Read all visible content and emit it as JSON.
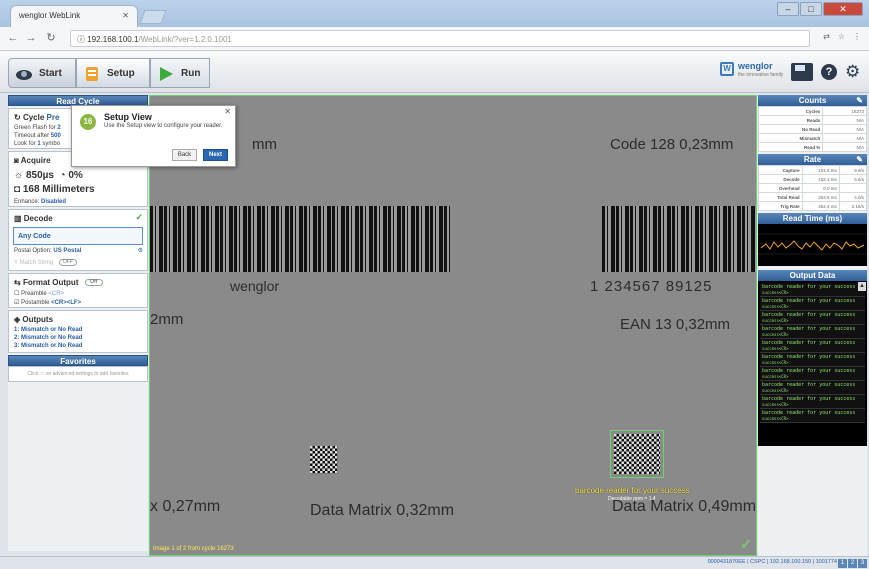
{
  "browser": {
    "tab_title": "wenglor WebLink",
    "url_host": "192.168.100.1",
    "url_path": "/WebLink/?ver=1.2.0.1001"
  },
  "header": {
    "steps": [
      "Start",
      "Setup",
      "Run"
    ],
    "brand": "wenglor",
    "brand_tagline": "the innovative family"
  },
  "left": {
    "read_cycle_title": "Read Cycle",
    "cycle_label": "Cycle",
    "cycle_mode": "Pre",
    "green_flash": "Green Flash for",
    "green_flash_val": "2",
    "timeout": "Timeout after",
    "timeout_val": "500",
    "look_for": "Look for",
    "look_for_val": "1",
    "look_for_tail": "symbo",
    "acquire_title": "Acquire",
    "exposure": "850µs",
    "gain": "0%",
    "distance": "168 Millimeters",
    "enhance_label": "Enhance:",
    "enhance_value": "Disabled",
    "decode_title": "Decode",
    "any_code": "Any Code",
    "postal_label": "Postal Option:",
    "postal_value": "US Postal",
    "match_string": "Match String",
    "match_toggle": "OFF",
    "format_title": "Format Output",
    "format_toggle": "Off",
    "preamble_label": "Preamble",
    "preamble_value": "<CR>",
    "postamble_label": "Postamble",
    "postamble_value": "<CR><LF>",
    "outputs_title": "Outputs",
    "outputs": [
      "1: Mismatch or No Read",
      "2: Mismatch or No Read",
      "3: Mismatch or No Read"
    ],
    "favorites_title": "Favorites",
    "favorites_hint": "Click ☆ on advanced settings to add favorites"
  },
  "dialog": {
    "step": "16",
    "title": "Setup View",
    "text": "Use the Setup view to configure your reader.",
    "back": "Back",
    "next": "Next"
  },
  "view": {
    "code128": "Code 128 0,23mm",
    "wenglor_label": "wenglor",
    "barcode_digits": "1  234567  89125",
    "ean13": "EAN 13 0,32mm",
    "partial_mm": "2mm",
    "dm_left": "x 0,27mm",
    "dm_center": "Data Matrix 0,32mm",
    "dm_right": "Data Matrix 0,49mm",
    "decode_result": "barcode reader for your success",
    "decode_sub": "Decodable ppm = 1.4",
    "footer": "Image 1 of 2 from cycle 16273",
    "camera_tag": "wenglor"
  },
  "right": {
    "counts_title": "Counts",
    "counts": [
      {
        "label": "Cycles",
        "value": "16273"
      },
      {
        "label": "Reads",
        "value": "N/A"
      },
      {
        "label": "No Read",
        "value": "N/A"
      },
      {
        "label": "Mismatch",
        "value": "N/A"
      },
      {
        "label": "Read %",
        "value": "N/A"
      }
    ],
    "rate_title": "Rate",
    "rates": [
      {
        "label": "Capture",
        "value": "101.3 ms",
        "value2": "9.9/s"
      },
      {
        "label": "Decode",
        "value": "152.1 ms",
        "value2": "6.6/s"
      },
      {
        "label": "Overhead",
        "value": "0.0 ms",
        "value2": ""
      },
      {
        "label": "Total Read",
        "value": "253.5 ms",
        "value2": "4.0/s"
      },
      {
        "label": "Trig Rate",
        "value": "462.4 ms",
        "value2": "2.16/s"
      }
    ],
    "readtime_title": "Read Time (ms)",
    "output_title": "Output Data",
    "output_items": [
      "barcode reader for your success",
      "barcode reader for your success",
      "barcode reader for your success",
      "barcode reader for your success",
      "barcode reader for your success",
      "barcode reader for your success",
      "barcode reader for your success",
      "barcode reader for your success",
      "barcode reader for your success",
      "barcode reader for your success"
    ],
    "output_subline": "success<CR>"
  },
  "status": {
    "text": "0000431870EE  |  CSPC  |  192.168.100.150  |  1001774",
    "pages": [
      "1",
      "2",
      "3"
    ]
  },
  "colors": {
    "accent_blue": "#2f5f98",
    "ok_green": "#3caa3c",
    "output_green": "#8fe26a"
  }
}
